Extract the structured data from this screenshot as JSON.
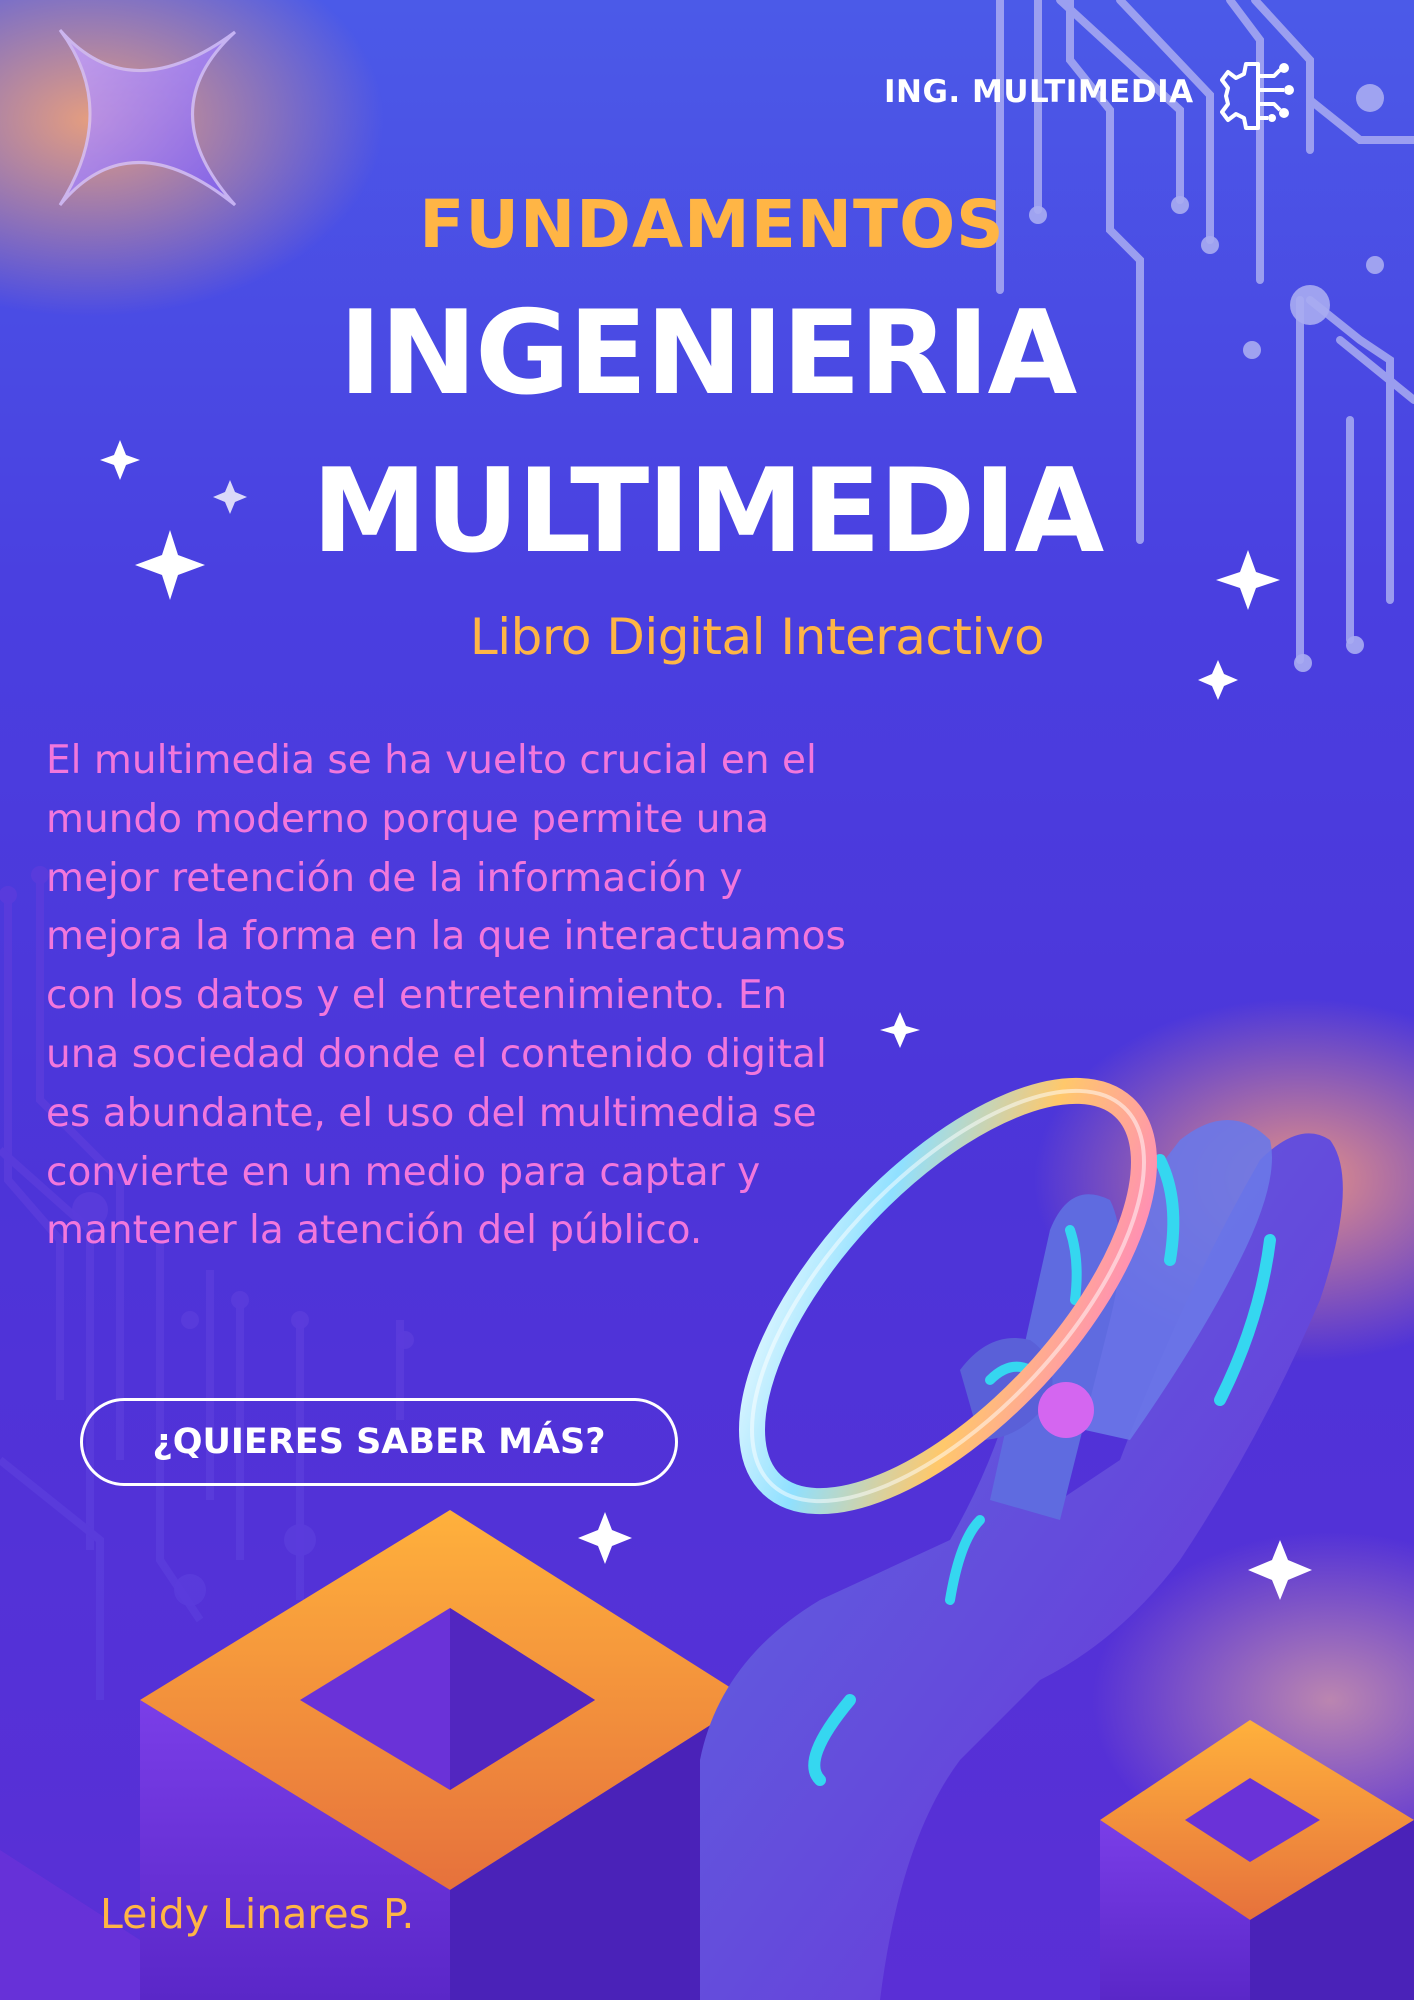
{
  "header": {
    "brand_label": "ING. MULTIMEDIA",
    "brand_icon": "gear-circuit-icon"
  },
  "title": {
    "top": "FUNDAMENTOS",
    "line_1": "INGENIERIA",
    "line_2": "MULTIMEDIA",
    "subtitle": "Libro Digital Interactivo"
  },
  "body": {
    "text": "El multimedia se ha vuelto crucial en el mundo moderno porque permite una mejor retención de la información y mejora la forma en la que interactuamos con los datos y el entretenimiento. En una sociedad donde el contenido digital es abundante, el uso del multimedia se convierte en un medio para captar y mantener la atención del público."
  },
  "cta": {
    "label": "¿QUIERES SABER MÁS?"
  },
  "footer": {
    "author": "Leidy Linares P."
  },
  "colors": {
    "accent_orange": "#ffb545",
    "body_pink": "#f277dc",
    "background_purple": "#4a3fe0",
    "white": "#ffffff"
  },
  "decorations": [
    "four-point-star-icon",
    "sparkle-icon",
    "circuit-lines",
    "iridescent-ring",
    "hand-illustration",
    "isometric-blocks"
  ]
}
